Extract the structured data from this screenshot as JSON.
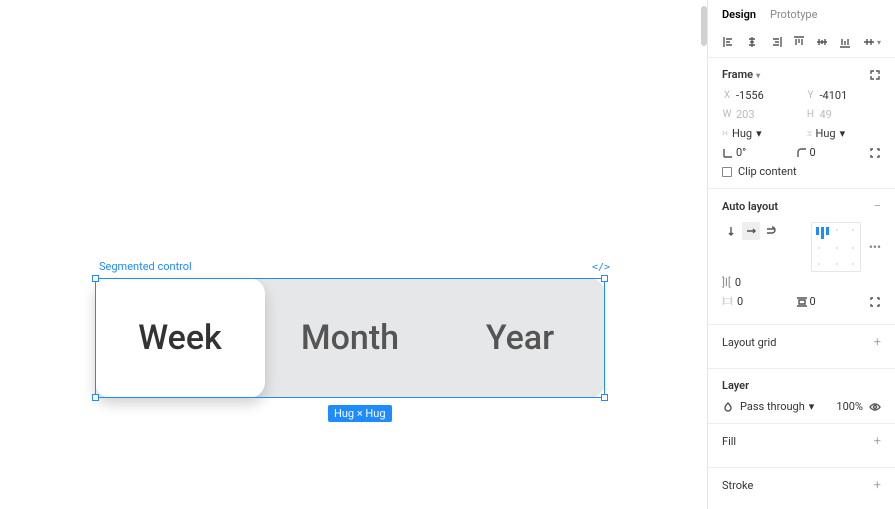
{
  "canvas": {
    "selection_label": "Segmented control",
    "dev_handoff": "</>",
    "dim_badge": "Hug × Hug",
    "segments": [
      "Week",
      "Month",
      "Year"
    ],
    "active_segment_index": 0
  },
  "panel": {
    "tabs": {
      "design": "Design",
      "prototype": "Prototype",
      "active": "Design"
    },
    "frame": {
      "title": "Frame",
      "x_label": "X",
      "x_value": "-1556",
      "y_label": "Y",
      "y_value": "-4101",
      "w_label": "W",
      "w_value": "203",
      "h_label": "H",
      "h_value": "49",
      "resize_h": "Hug",
      "resize_v": "Hug",
      "rotation": "0°",
      "radius": "0",
      "clip_content": "Clip content"
    },
    "auto_layout": {
      "title": "Auto layout",
      "spacing_between": "0",
      "padding_h": "0",
      "padding_v": "0"
    },
    "layout_grid": {
      "title": "Layout grid"
    },
    "layer": {
      "title": "Layer",
      "blend_mode": "Pass through",
      "opacity": "100%"
    },
    "fill": {
      "title": "Fill"
    },
    "stroke": {
      "title": "Stroke"
    }
  }
}
